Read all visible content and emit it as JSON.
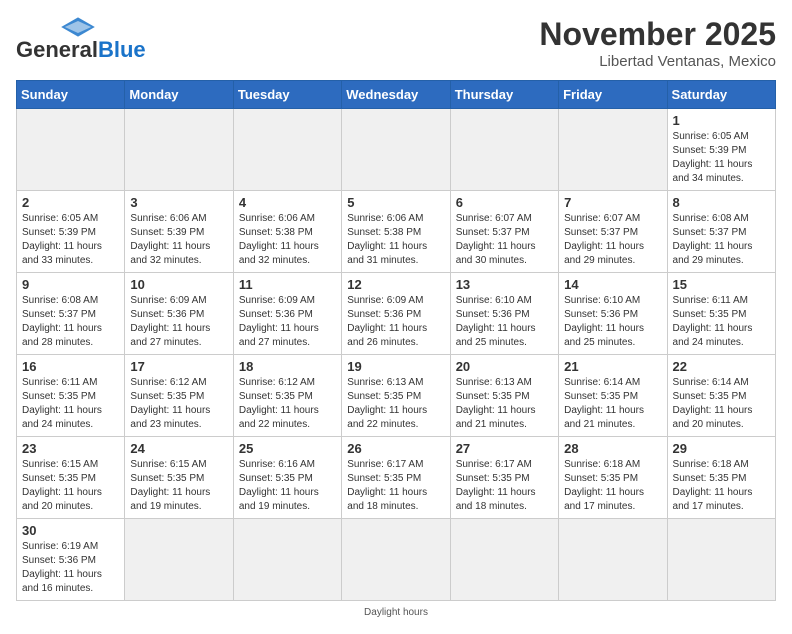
{
  "header": {
    "logo_line1": "General",
    "logo_line2": "Blue",
    "month_title": "November 2025",
    "subtitle": "Libertad Ventanas, Mexico"
  },
  "weekdays": [
    "Sunday",
    "Monday",
    "Tuesday",
    "Wednesday",
    "Thursday",
    "Friday",
    "Saturday"
  ],
  "weeks": [
    [
      {
        "day": "",
        "info": ""
      },
      {
        "day": "",
        "info": ""
      },
      {
        "day": "",
        "info": ""
      },
      {
        "day": "",
        "info": ""
      },
      {
        "day": "",
        "info": ""
      },
      {
        "day": "",
        "info": ""
      },
      {
        "day": "1",
        "info": "Sunrise: 6:05 AM\nSunset: 5:39 PM\nDaylight: 11 hours\nand 34 minutes."
      }
    ],
    [
      {
        "day": "2",
        "info": "Sunrise: 6:05 AM\nSunset: 5:39 PM\nDaylight: 11 hours\nand 33 minutes."
      },
      {
        "day": "3",
        "info": "Sunrise: 6:06 AM\nSunset: 5:39 PM\nDaylight: 11 hours\nand 32 minutes."
      },
      {
        "day": "4",
        "info": "Sunrise: 6:06 AM\nSunset: 5:38 PM\nDaylight: 11 hours\nand 32 minutes."
      },
      {
        "day": "5",
        "info": "Sunrise: 6:06 AM\nSunset: 5:38 PM\nDaylight: 11 hours\nand 31 minutes."
      },
      {
        "day": "6",
        "info": "Sunrise: 6:07 AM\nSunset: 5:37 PM\nDaylight: 11 hours\nand 30 minutes."
      },
      {
        "day": "7",
        "info": "Sunrise: 6:07 AM\nSunset: 5:37 PM\nDaylight: 11 hours\nand 29 minutes."
      },
      {
        "day": "8",
        "info": "Sunrise: 6:08 AM\nSunset: 5:37 PM\nDaylight: 11 hours\nand 29 minutes."
      }
    ],
    [
      {
        "day": "9",
        "info": "Sunrise: 6:08 AM\nSunset: 5:37 PM\nDaylight: 11 hours\nand 28 minutes."
      },
      {
        "day": "10",
        "info": "Sunrise: 6:09 AM\nSunset: 5:36 PM\nDaylight: 11 hours\nand 27 minutes."
      },
      {
        "day": "11",
        "info": "Sunrise: 6:09 AM\nSunset: 5:36 PM\nDaylight: 11 hours\nand 27 minutes."
      },
      {
        "day": "12",
        "info": "Sunrise: 6:09 AM\nSunset: 5:36 PM\nDaylight: 11 hours\nand 26 minutes."
      },
      {
        "day": "13",
        "info": "Sunrise: 6:10 AM\nSunset: 5:36 PM\nDaylight: 11 hours\nand 25 minutes."
      },
      {
        "day": "14",
        "info": "Sunrise: 6:10 AM\nSunset: 5:36 PM\nDaylight: 11 hours\nand 25 minutes."
      },
      {
        "day": "15",
        "info": "Sunrise: 6:11 AM\nSunset: 5:35 PM\nDaylight: 11 hours\nand 24 minutes."
      }
    ],
    [
      {
        "day": "16",
        "info": "Sunrise: 6:11 AM\nSunset: 5:35 PM\nDaylight: 11 hours\nand 24 minutes."
      },
      {
        "day": "17",
        "info": "Sunrise: 6:12 AM\nSunset: 5:35 PM\nDaylight: 11 hours\nand 23 minutes."
      },
      {
        "day": "18",
        "info": "Sunrise: 6:12 AM\nSunset: 5:35 PM\nDaylight: 11 hours\nand 22 minutes."
      },
      {
        "day": "19",
        "info": "Sunrise: 6:13 AM\nSunset: 5:35 PM\nDaylight: 11 hours\nand 22 minutes."
      },
      {
        "day": "20",
        "info": "Sunrise: 6:13 AM\nSunset: 5:35 PM\nDaylight: 11 hours\nand 21 minutes."
      },
      {
        "day": "21",
        "info": "Sunrise: 6:14 AM\nSunset: 5:35 PM\nDaylight: 11 hours\nand 21 minutes."
      },
      {
        "day": "22",
        "info": "Sunrise: 6:14 AM\nSunset: 5:35 PM\nDaylight: 11 hours\nand 20 minutes."
      }
    ],
    [
      {
        "day": "23",
        "info": "Sunrise: 6:15 AM\nSunset: 5:35 PM\nDaylight: 11 hours\nand 20 minutes."
      },
      {
        "day": "24",
        "info": "Sunrise: 6:15 AM\nSunset: 5:35 PM\nDaylight: 11 hours\nand 19 minutes."
      },
      {
        "day": "25",
        "info": "Sunrise: 6:16 AM\nSunset: 5:35 PM\nDaylight: 11 hours\nand 19 minutes."
      },
      {
        "day": "26",
        "info": "Sunrise: 6:17 AM\nSunset: 5:35 PM\nDaylight: 11 hours\nand 18 minutes."
      },
      {
        "day": "27",
        "info": "Sunrise: 6:17 AM\nSunset: 5:35 PM\nDaylight: 11 hours\nand 18 minutes."
      },
      {
        "day": "28",
        "info": "Sunrise: 6:18 AM\nSunset: 5:35 PM\nDaylight: 11 hours\nand 17 minutes."
      },
      {
        "day": "29",
        "info": "Sunrise: 6:18 AM\nSunset: 5:35 PM\nDaylight: 11 hours\nand 17 minutes."
      }
    ],
    [
      {
        "day": "30",
        "info": "Sunrise: 6:19 AM\nSunset: 5:36 PM\nDaylight: 11 hours\nand 16 minutes."
      },
      {
        "day": "",
        "info": ""
      },
      {
        "day": "",
        "info": ""
      },
      {
        "day": "",
        "info": ""
      },
      {
        "day": "",
        "info": ""
      },
      {
        "day": "",
        "info": ""
      },
      {
        "day": "",
        "info": ""
      }
    ]
  ],
  "footer_note": "Daylight hours"
}
